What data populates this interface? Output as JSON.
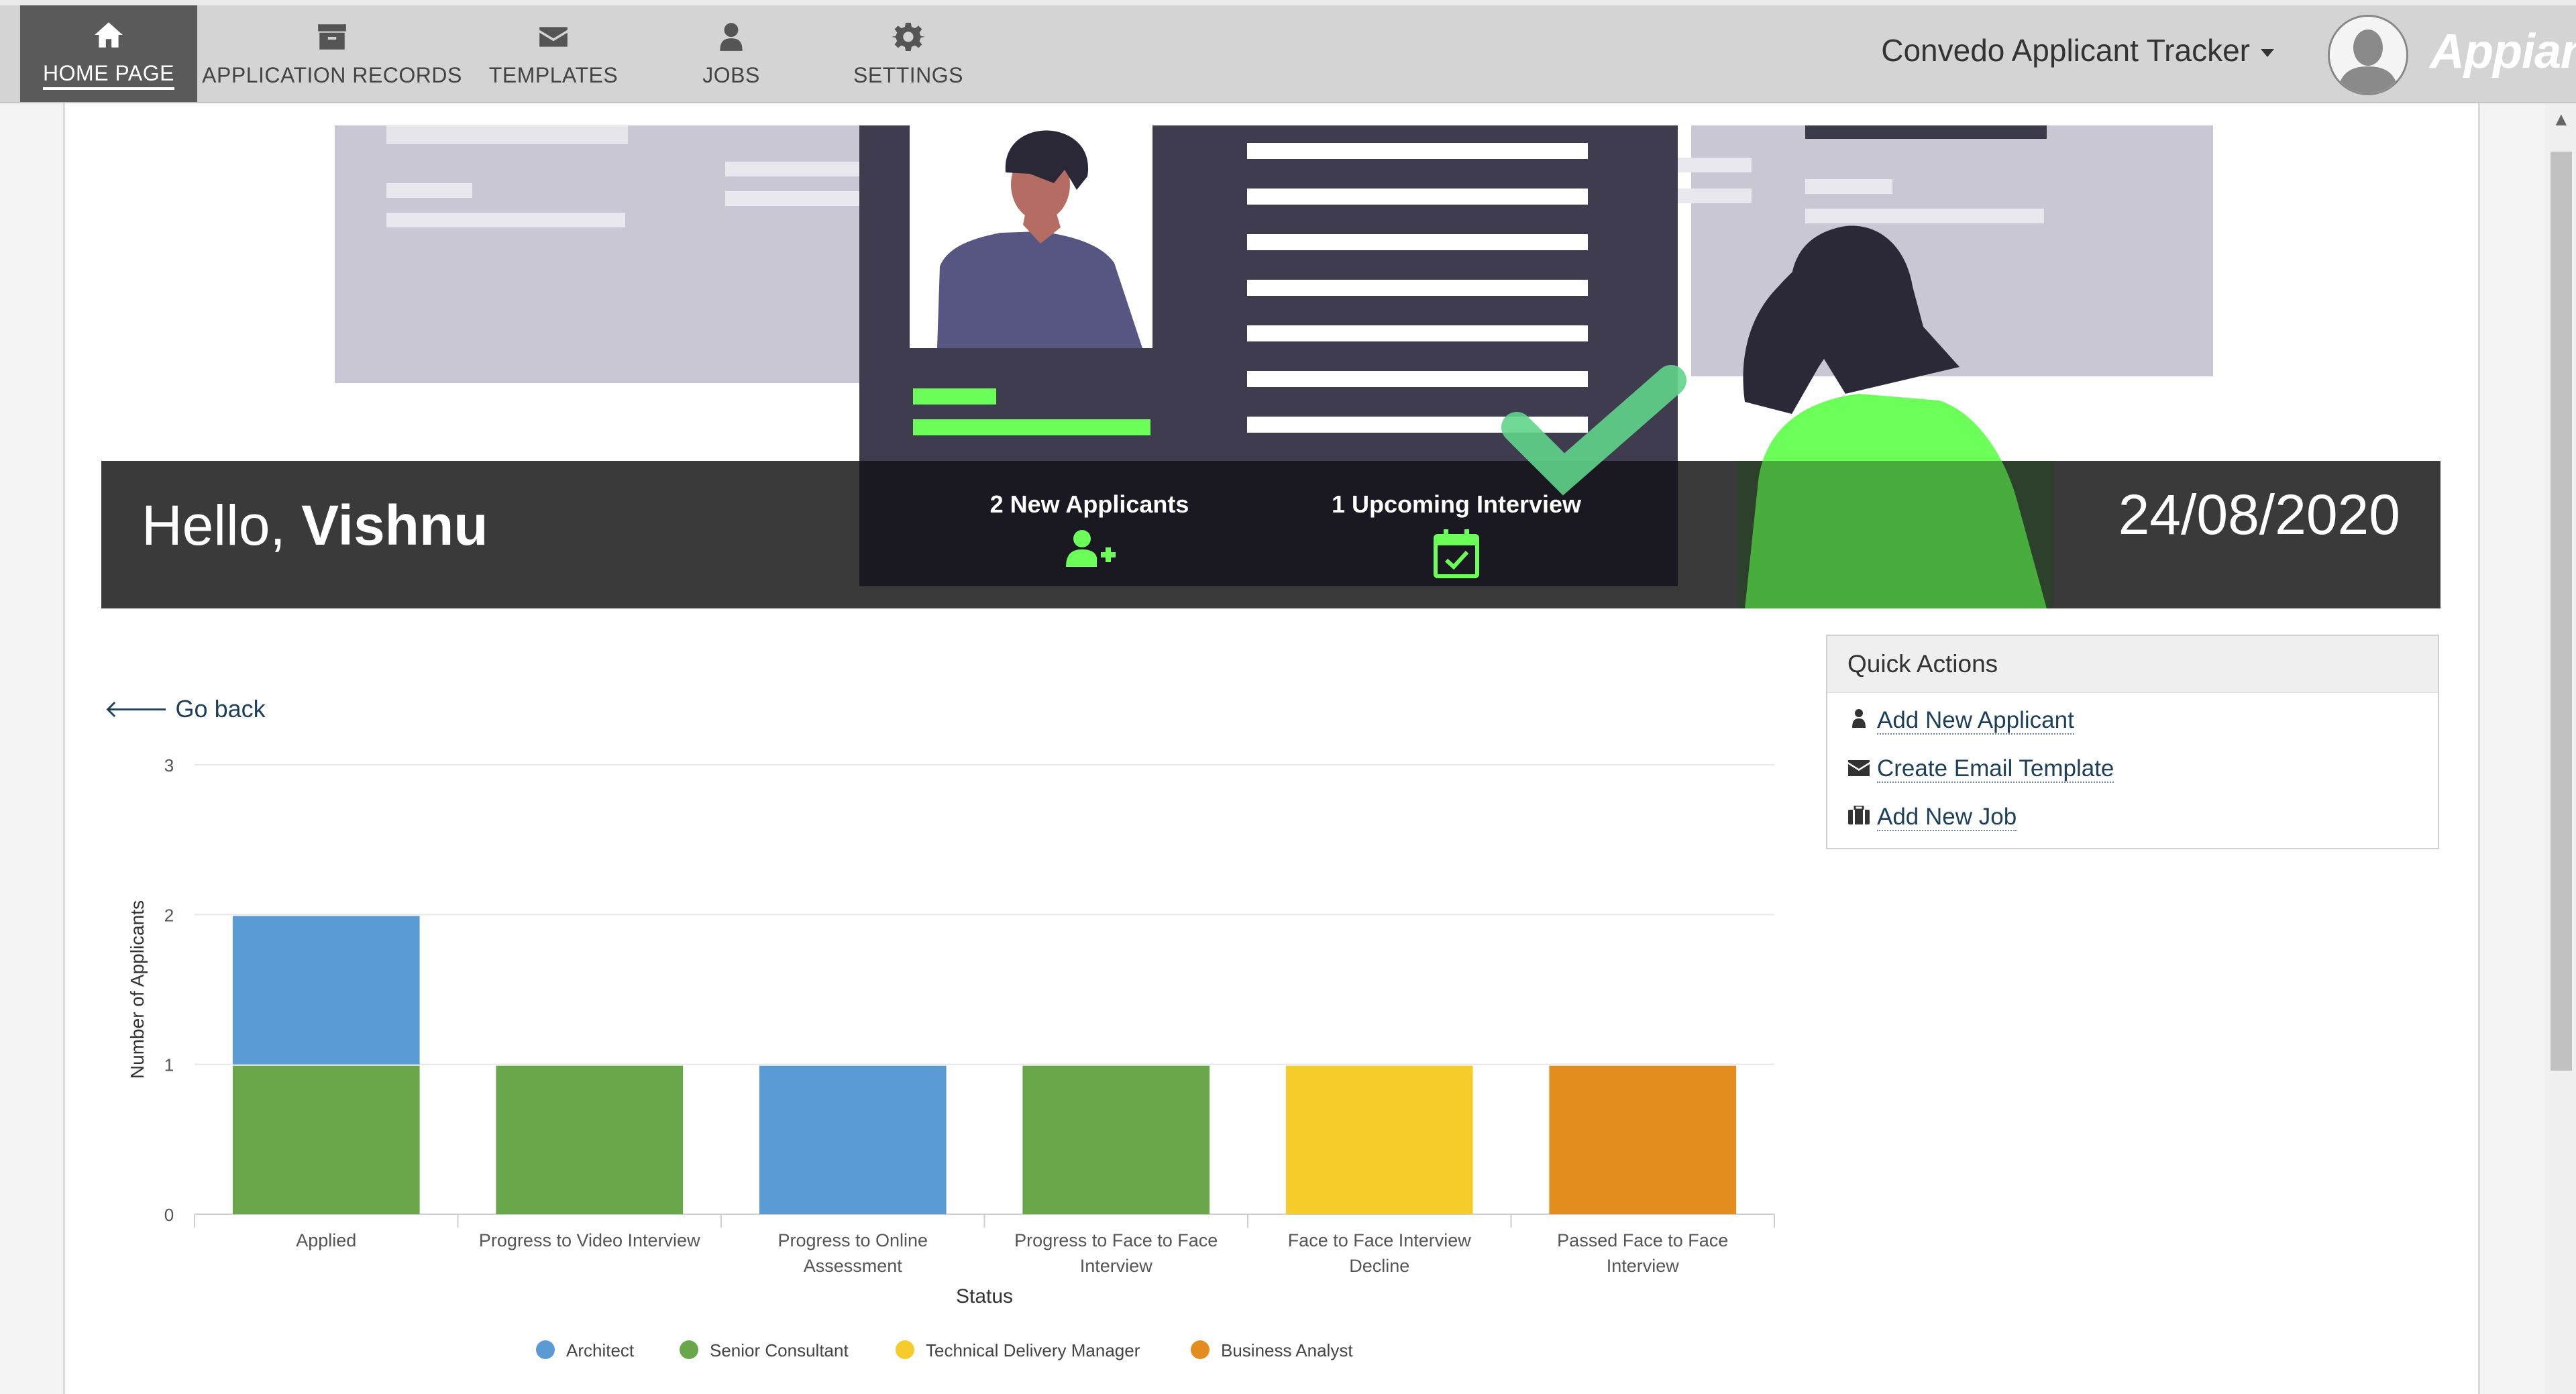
{
  "nav": {
    "items": [
      {
        "label": "HOME PAGE",
        "icon": "home-icon",
        "active": true
      },
      {
        "label": "APPLICATION RECORDS",
        "icon": "archive-icon",
        "active": false
      },
      {
        "label": "TEMPLATES",
        "icon": "envelope-icon",
        "active": false
      },
      {
        "label": "JOBS",
        "icon": "user-icon",
        "active": false
      },
      {
        "label": "SETTINGS",
        "icon": "gear-icon",
        "active": false
      }
    ],
    "app_name": "Convedo Applicant Tracker",
    "brand": "Appian"
  },
  "banner": {
    "greeting": "Hello,",
    "user": "Vishnu",
    "new_applicants": "2 New Applicants",
    "upcoming_interview": "1 Upcoming Interview",
    "date": "24/08/2020"
  },
  "go_back": "Go back",
  "quick_actions": {
    "title": "Quick Actions",
    "items": [
      {
        "label": "Add New Applicant",
        "icon": "user-icon"
      },
      {
        "label": "Create Email Template",
        "icon": "envelope-icon"
      },
      {
        "label": "Add New Job",
        "icon": "briefcase-icon"
      }
    ]
  },
  "colors": {
    "accent_green": "#6cff5a",
    "architect": "#5b9bd5",
    "senior_consultant": "#6aa64a",
    "technical_delivery_manager": "#f5cc2a",
    "business_analyst": "#e38d1e"
  },
  "chart_data": {
    "type": "bar",
    "stacked": true,
    "categories": [
      "Applied",
      "Progress to Video Interview",
      "Progress to Online Assessment",
      "Progress to Face to Face Interview",
      "Face to Face Interview Decline",
      "Passed Face to Face Interview"
    ],
    "category_lines": [
      [
        "Applied"
      ],
      [
        "Progress to Video Interview"
      ],
      [
        "Progress to Online",
        "Assessment"
      ],
      [
        "Progress to Face to Face",
        "Interview"
      ],
      [
        "Face to Face Interview",
        "Decline"
      ],
      [
        "Passed Face to Face",
        "Interview"
      ]
    ],
    "series": [
      {
        "name": "Senior Consultant",
        "color": "#6aa64a",
        "values": [
          1,
          1,
          0,
          1,
          0,
          0
        ]
      },
      {
        "name": "Architect",
        "color": "#5b9bd5",
        "values": [
          1,
          0,
          1,
          0,
          0,
          0
        ]
      },
      {
        "name": "Technical Delivery Manager",
        "color": "#f5cc2a",
        "values": [
          0,
          0,
          0,
          0,
          1,
          0
        ]
      },
      {
        "name": "Business Analyst",
        "color": "#e38d1e",
        "values": [
          0,
          0,
          0,
          0,
          0,
          1
        ]
      }
    ],
    "legend_order": [
      "Architect",
      "Senior Consultant",
      "Technical Delivery Manager",
      "Business Analyst"
    ],
    "xlabel": "Status",
    "ylabel": "Number of Applicants",
    "ylim": [
      0,
      3
    ],
    "yticks": [
      "0",
      "1",
      "2",
      "3"
    ],
    "grid": true,
    "legend_position": "bottom-center"
  }
}
